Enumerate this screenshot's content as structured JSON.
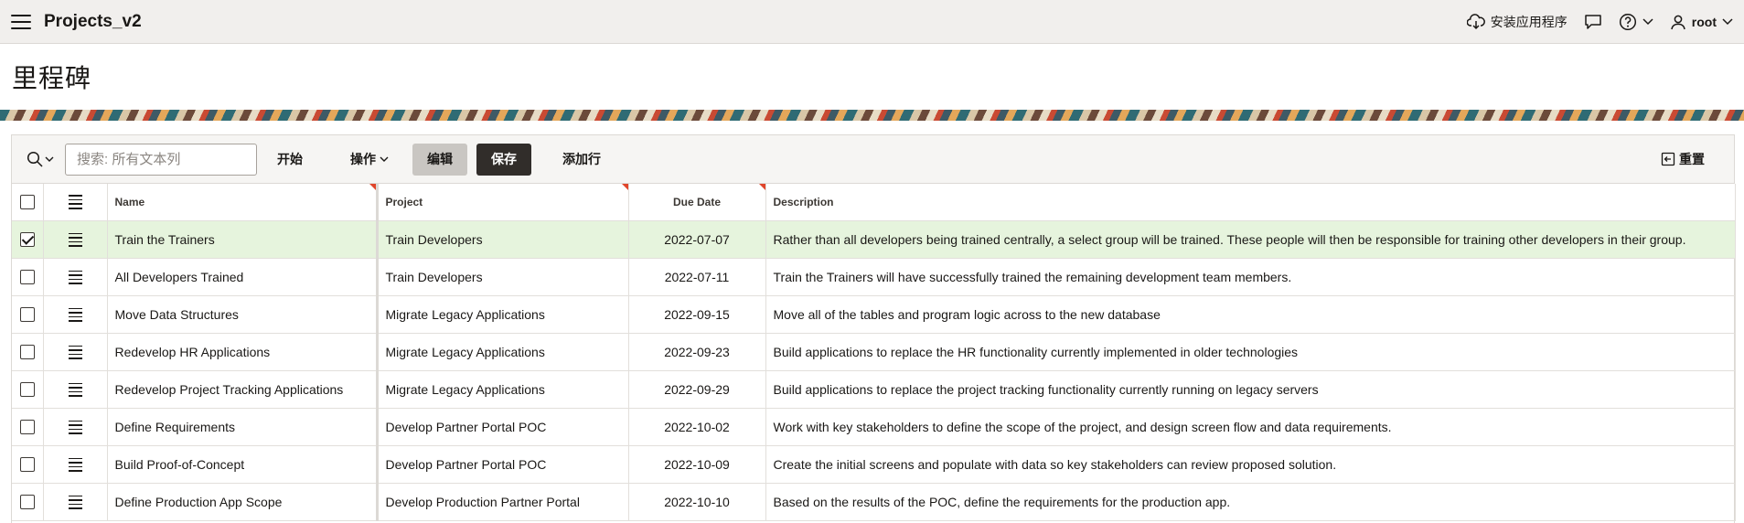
{
  "app": {
    "title": "Projects_v2"
  },
  "topbar": {
    "install_label": "安装应用程序",
    "user_label": "root"
  },
  "page": {
    "title": "里程碑"
  },
  "toolbar": {
    "search_placeholder": "搜索: 所有文本列",
    "start_label": "开始",
    "actions_label": "操作",
    "edit_label": "编辑",
    "save_label": "保存",
    "add_row_label": "添加行",
    "reset_label": "重置"
  },
  "table": {
    "columns": [
      "Name",
      "Project",
      "Due Date",
      "Description"
    ],
    "rows": [
      {
        "selected": true,
        "name": "Train the Trainers",
        "project": "Train Developers",
        "due": "2022-07-07",
        "description": "Rather than all developers being trained centrally, a select group will be trained. These people will then be responsible for training other developers in their group."
      },
      {
        "selected": false,
        "name": "All Developers Trained",
        "project": "Train Developers",
        "due": "2022-07-11",
        "description": "Train the Trainers will have successfully trained the remaining development team members."
      },
      {
        "selected": false,
        "name": "Move Data Structures",
        "project": "Migrate Legacy Applications",
        "due": "2022-09-15",
        "description": "Move all of the tables and program logic across to the new database"
      },
      {
        "selected": false,
        "name": "Redevelop HR Applications",
        "project": "Migrate Legacy Applications",
        "due": "2022-09-23",
        "description": "Build applications to replace the HR functionality currently implemented in older technologies"
      },
      {
        "selected": false,
        "name": "Redevelop Project Tracking Applications",
        "project": "Migrate Legacy Applications",
        "due": "2022-09-29",
        "description": "Build applications to replace the project tracking functionality currently running on legacy servers"
      },
      {
        "selected": false,
        "name": "Define Requirements",
        "project": "Develop Partner Portal POC",
        "due": "2022-10-02",
        "description": "Work with key stakeholders to define the scope of the project, and design screen flow and data requirements."
      },
      {
        "selected": false,
        "name": "Build Proof-of-Concept",
        "project": "Develop Partner Portal POC",
        "due": "2022-10-09",
        "description": "Create the initial screens and populate with data so key stakeholders can review proposed solution."
      },
      {
        "selected": false,
        "name": "Define Production App Scope",
        "project": "Develop Production Partner Portal",
        "due": "2022-10-10",
        "description": "Based on the results of the POC, define the requirements for the production app."
      }
    ]
  }
}
